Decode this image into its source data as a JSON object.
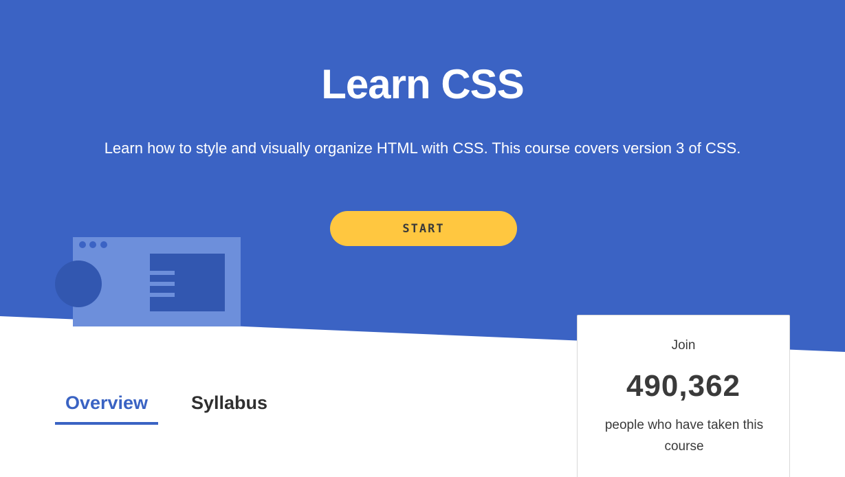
{
  "hero": {
    "title": "Learn CSS",
    "subtitle": "Learn how to style and visually organize HTML with CSS. This course covers version 3 of CSS.",
    "start_label": "START",
    "background_color": "#3b63c4",
    "button_color": "#ffc740"
  },
  "tabs": [
    {
      "label": "Overview",
      "active": true
    },
    {
      "label": "Syllabus",
      "active": false
    }
  ],
  "join_card": {
    "label": "Join",
    "count": "490,362",
    "description": "people who have taken this course"
  },
  "illustration": {
    "icon": "browser-window-icon"
  }
}
